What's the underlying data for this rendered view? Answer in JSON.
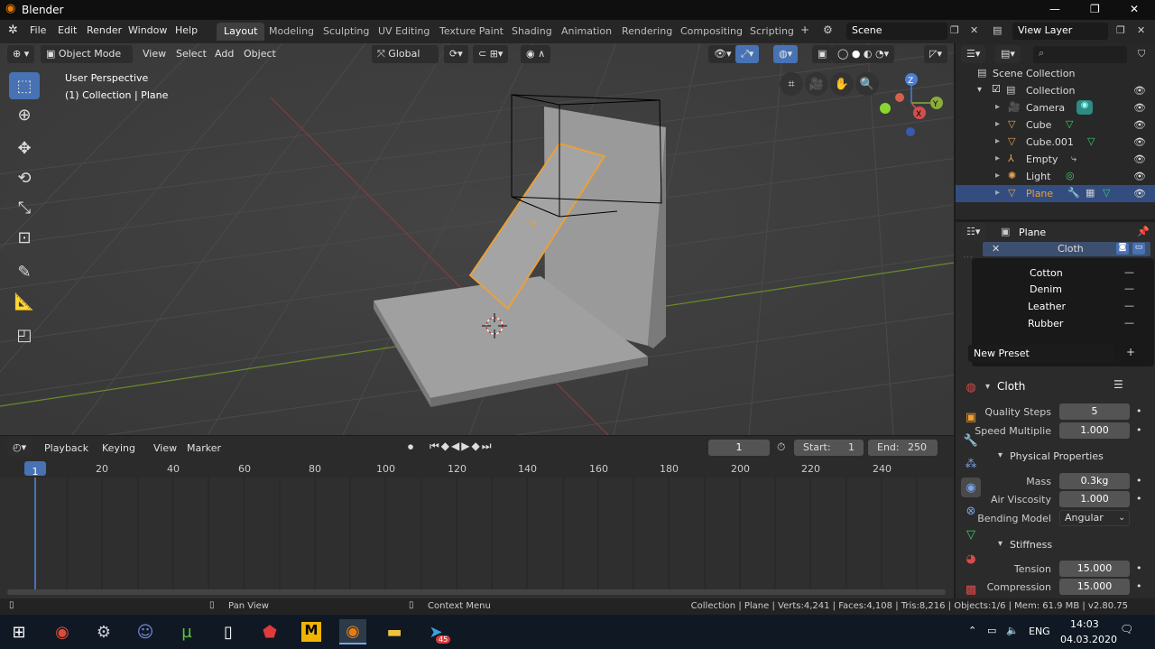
{
  "window": {
    "title": "Blender",
    "minimize": "—",
    "restore": "❐",
    "close": "✕"
  },
  "menus": [
    "File",
    "Edit",
    "Render",
    "Window",
    "Help"
  ],
  "workspaces": [
    "Layout",
    "Modeling",
    "Sculpting",
    "UV Editing",
    "Texture Paint",
    "Shading",
    "Animation",
    "Rendering",
    "Compositing",
    "Scripting"
  ],
  "scene": {
    "name": "Scene",
    "view_layer": "View Layer"
  },
  "viewport": {
    "mode": "Object Mode",
    "menus": [
      "View",
      "Select",
      "Add",
      "Object"
    ],
    "orientation": "Global",
    "info_line1": "User Perspective",
    "info_line2": "(1) Collection | Plane"
  },
  "timeline": {
    "menus": [
      "Playback",
      "Keying",
      "View",
      "Marker"
    ],
    "current_frame": "1",
    "start_label": "Start:",
    "start": "1",
    "end_label": "End:",
    "end": "250",
    "ruler": [
      "1",
      "20",
      "40",
      "60",
      "80",
      "100",
      "120",
      "140",
      "160",
      "180",
      "200",
      "220",
      "240"
    ]
  },
  "status": {
    "pan": "Pan View",
    "context": "Context Menu",
    "stats": "Collection | Plane | Verts:4,241 | Faces:4,108 | Tris:8,216 | Objects:1/6 | Mem: 61.9 MB | v2.80.75"
  },
  "outliner": {
    "root": "Scene Collection",
    "collection": "Collection",
    "items": [
      {
        "name": "Camera",
        "icon": "camera-icon",
        "color": "#e8a34c"
      },
      {
        "name": "Cube",
        "icon": "mesh-icon",
        "color": "#e8a34c"
      },
      {
        "name": "Cube.001",
        "icon": "mesh-icon",
        "color": "#e8a34c"
      },
      {
        "name": "Empty",
        "icon": "empty-icon",
        "color": "#e8a34c"
      },
      {
        "name": "Light",
        "icon": "light-icon",
        "color": "#e8a34c"
      },
      {
        "name": "Plane",
        "icon": "mesh-icon",
        "color": "#e8a34c"
      }
    ],
    "selected_color": "#f0a030"
  },
  "properties": {
    "object": "Plane",
    "modifier": "Cloth",
    "presets": [
      "Cotton",
      "Denim",
      "Leather",
      "Rubber"
    ],
    "new_preset": "New Preset",
    "panel": "Cloth",
    "quality_label": "Quality Steps",
    "quality": "5",
    "speed_label": "Speed Multiplie",
    "speed": "1.000",
    "physical": "Physical Properties",
    "mass_label": "Mass",
    "mass": "0.3kg",
    "air_label": "Air Viscosity",
    "air": "1.000",
    "bending_label": "Bending Model",
    "bending": "Angular",
    "stiffness": "Stiffness",
    "tension_label": "Tension",
    "tension": "15.000",
    "compression_label": "Compression",
    "compression": "15.000"
  },
  "taskbar": {
    "lang": "ENG",
    "time": "14:03",
    "date": "04.03.2020",
    "badge": "45"
  },
  "colors": {
    "accent": "#4772b3",
    "selection": "#f0a030"
  }
}
